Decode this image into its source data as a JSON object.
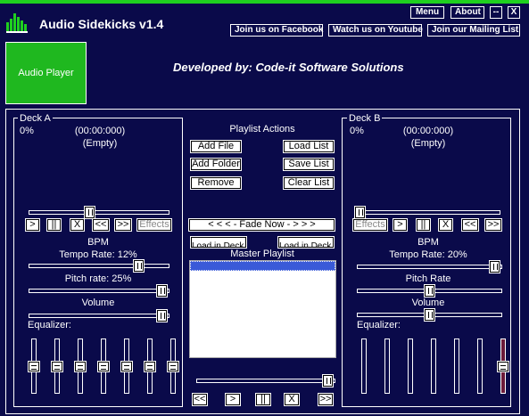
{
  "app": {
    "title": "Audio Sidekicks v1.4",
    "credit": "Developed by: Code-it Software Solutions"
  },
  "topbar": {
    "menu": "Menu",
    "about": "About",
    "minimize": "--",
    "close": "X"
  },
  "links": {
    "facebook": "Join us on Facebook",
    "youtube": "Watch us on Youtube",
    "mailing": "Join our Mailing List"
  },
  "sidebar": {
    "audio_player": "Audio Player"
  },
  "deck_a": {
    "label": "Deck A",
    "percent": "0%",
    "time": "(00:00:000)",
    "track": "(Empty)",
    "effects": "Effects",
    "bpm": "BPM",
    "tempo": "Tempo Rate: 12%",
    "pitch": "Pitch rate: 25%",
    "volume": "Volume",
    "equalizer": "Equalizer:",
    "position": 0.43,
    "tempo_level": 0.8,
    "pitch_level": 0.98,
    "volume_level": 0.98,
    "eq_levels": [
      0.5,
      0.5,
      0.5,
      0.5,
      0.5,
      0.5,
      0.5
    ]
  },
  "deck_b": {
    "label": "Deck B",
    "percent": "0%",
    "time": "(00:00:000)",
    "track": "(Empty)",
    "effects": "Effects",
    "bpm": "BPM",
    "tempo": "Tempo Rate: 20%",
    "pitch": "Pitch Rate",
    "volume": "Volume",
    "equalizer": "Equalizer:",
    "position": 0.0,
    "tempo_level": 0.98,
    "pitch_level": 0.5,
    "volume_level": 0.5,
    "eq_levels": [
      0,
      0,
      0,
      0,
      0,
      0,
      0.5
    ]
  },
  "transport": {
    "play": ">",
    "pause": "||",
    "stop": "X",
    "prev": "<<",
    "next": ">>"
  },
  "playlist": {
    "title": "Playlist Actions",
    "add_file": "Add File",
    "load_list": "Load List",
    "add_folder": "Add Folder",
    "save_list": "Save List",
    "remove": "Remove",
    "clear_list": "Clear List",
    "fade_now": "< < < - Fade Now - > > >",
    "load_a": "Load in Deck A",
    "load_b": "Load in Deck B",
    "master": "Master Playlist",
    "master_volume": 0.98
  },
  "colors": {
    "background": "#0a0a4a",
    "accent_green": "#1fd01f",
    "selection": "#3a5ad8",
    "eq_highlight": "#6b1a3a"
  }
}
